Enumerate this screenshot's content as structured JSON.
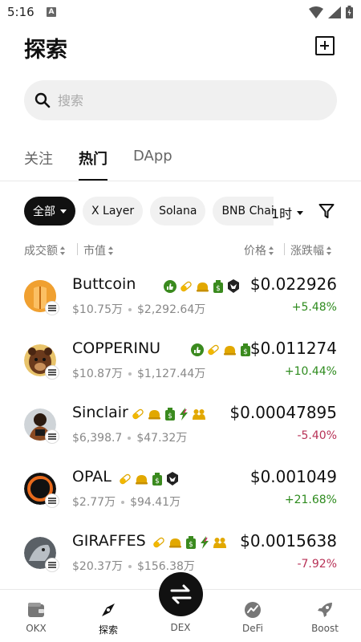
{
  "status_bar": {
    "time": "5:16",
    "notification_letter": "A"
  },
  "header": {
    "title": "探索"
  },
  "search": {
    "placeholder": "搜索"
  },
  "tabs": [
    {
      "label": "关注",
      "active": false
    },
    {
      "label": "热门",
      "active": true
    },
    {
      "label": "DApp",
      "active": false
    }
  ],
  "chips": [
    {
      "label": "全部",
      "active": true
    },
    {
      "label": "X Layer",
      "active": false
    },
    {
      "label": "Solana",
      "active": false
    },
    {
      "label": "BNB Chain",
      "active": false
    }
  ],
  "time_filter": {
    "label": "1时"
  },
  "sort_header": {
    "volume": "成交额",
    "market_cap": "市值",
    "price": "价格",
    "change": "涨跌幅"
  },
  "colors": {
    "up": "#2e8b1e",
    "down": "#b83257",
    "accent": "#111111"
  },
  "tokens": [
    {
      "name": "Buttcoin",
      "tags": [
        "like-icon",
        "pill-icon",
        "cap-icon",
        "moneybag-icon",
        "raven-icon"
      ],
      "volume": "$10.75万",
      "market_cap": "$2,292.64万",
      "price": "$0.022926",
      "change": "+5.48%",
      "direction": "up"
    },
    {
      "name": "COPPERINU",
      "tags": [
        "like-icon",
        "pill-icon",
        "cap-icon",
        "moneybag-icon"
      ],
      "volume": "$10.87万",
      "market_cap": "$1,127.44万",
      "price": "$0.011274",
      "change": "+10.44%",
      "direction": "up"
    },
    {
      "name": "Sinclair",
      "tags": [
        "pill-icon",
        "cap-icon",
        "moneybag-icon",
        "bolt-icon",
        "people-icon"
      ],
      "volume": "$6,398.7",
      "market_cap": "$47.32万",
      "price": "$0.00047895",
      "change": "-5.40%",
      "direction": "down"
    },
    {
      "name": "OPAL",
      "tags": [
        "pill-icon",
        "cap-icon",
        "moneybag-icon",
        "raven-icon"
      ],
      "volume": "$2.77万",
      "market_cap": "$94.41万",
      "price": "$0.001049",
      "change": "+21.68%",
      "direction": "up"
    },
    {
      "name": "GIRAFFES",
      "tags": [
        "pill-icon",
        "cap-icon",
        "moneybag-icon",
        "bolt-icon",
        "people-icon"
      ],
      "volume": "$20.37万",
      "market_cap": "$156.38万",
      "price": "$0.0015638",
      "change": "-7.92%",
      "direction": "down"
    }
  ],
  "bottom_nav": [
    {
      "label": "OKX",
      "icon": "wallet-icon",
      "active": false
    },
    {
      "label": "探索",
      "icon": "compass-icon",
      "active": true
    },
    {
      "label": "DEX",
      "icon": "swap-icon",
      "active": false
    },
    {
      "label": "DeFi",
      "icon": "chart-icon",
      "active": false
    },
    {
      "label": "Boost",
      "icon": "rocket-icon",
      "active": false
    }
  ]
}
